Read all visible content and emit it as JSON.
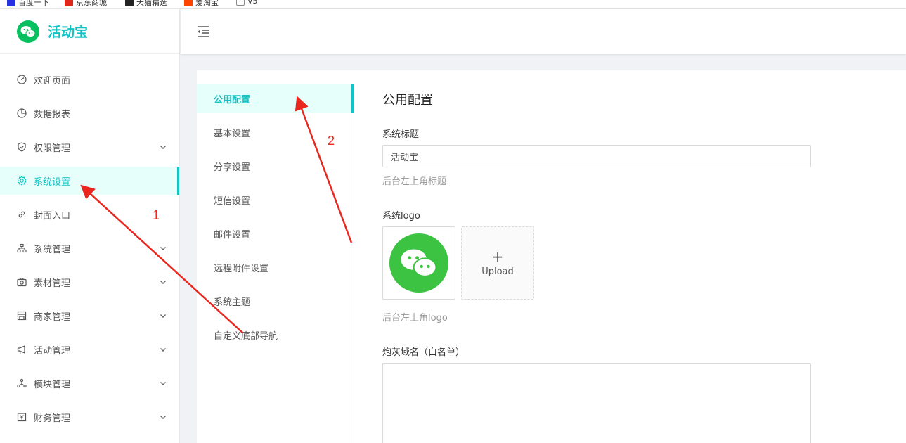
{
  "bookmarks": [
    {
      "label": "百度一下",
      "color": "#2932e1"
    },
    {
      "label": "京东商城",
      "color": "#e1251b"
    },
    {
      "label": "天猫精选",
      "color": "#222222"
    },
    {
      "label": "爱淘宝",
      "color": "#ff4400"
    },
    {
      "label": "V5",
      "color": "#888888"
    }
  ],
  "sidebar": {
    "app_title": "活动宝",
    "brand_color": "#13c2c2",
    "items": [
      {
        "label": "欢迎页面",
        "icon": "dashboard-icon"
      },
      {
        "label": "数据报表",
        "icon": "pie-chart-icon"
      },
      {
        "label": "权限管理",
        "icon": "shield-icon"
      },
      {
        "label": "系统设置",
        "icon": "gear-icon"
      },
      {
        "label": "封面入口",
        "icon": "link-icon"
      },
      {
        "label": "系统管理",
        "icon": "cluster-icon"
      },
      {
        "label": "素材管理",
        "icon": "camera-icon"
      },
      {
        "label": "商家管理",
        "icon": "shop-icon"
      },
      {
        "label": "活动管理",
        "icon": "megaphone-icon"
      },
      {
        "label": "模块管理",
        "icon": "nodes-icon"
      },
      {
        "label": "财务管理",
        "icon": "money-icon"
      }
    ]
  },
  "submenu": {
    "items": [
      {
        "label": "公用配置"
      },
      {
        "label": "基本设置"
      },
      {
        "label": "分享设置"
      },
      {
        "label": "短信设置"
      },
      {
        "label": "邮件设置"
      },
      {
        "label": "远程附件设置"
      },
      {
        "label": "系统主题"
      },
      {
        "label": "自定义底部导航"
      }
    ]
  },
  "content": {
    "heading": "公用配置",
    "system_title_label": "系统标题",
    "system_title_value": "活动宝",
    "system_title_hint": "后台左上角标题",
    "logo_label": "系统logo",
    "upload_label": "Upload",
    "logo_hint": "后台左上角logo",
    "domain_label": "炮灰域名（白名单）"
  },
  "annotations": {
    "num1": "1",
    "num2": "2",
    "color": "#e8271f"
  }
}
